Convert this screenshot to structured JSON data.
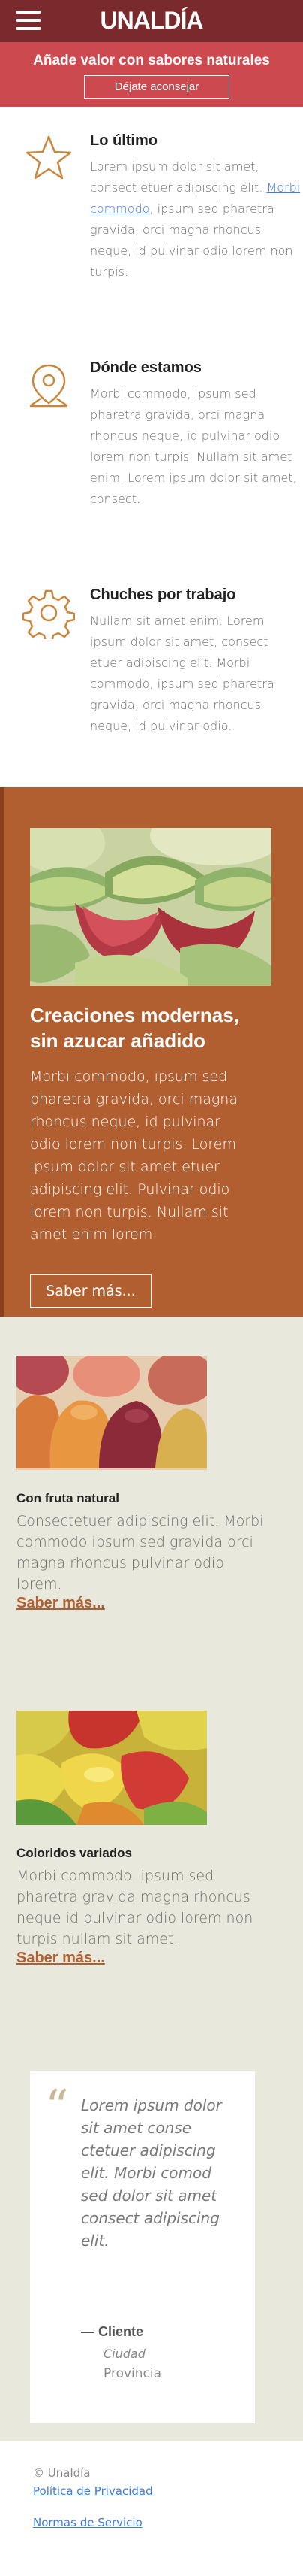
{
  "header": {
    "brand": "UNALDÍA",
    "menu_icon": "hamburger-menu-icon"
  },
  "promo": {
    "text": "Añade valor con sabores naturales",
    "button": "Déjate aconsejar"
  },
  "features": [
    {
      "icon": "star-icon",
      "title": "Lo último",
      "text_before": "Lorem ipsum dolor sit amet, consect etuer adipiscing elit.",
      "link": "Morbi commodo",
      "text_after": ", ipsum sed pharetra gravida, orci magna rhoncus neque, id pulvinar odio lorem non turpis."
    },
    {
      "icon": "map-pin-icon",
      "title": "Dónde estamos",
      "text": "Morbi commodo, ipsum sed pharetra gravida, orci magna rhoncus neque, id pulvinar odio lorem non turpis. Nullam sit amet enim. Lorem ipsum dolor sit amet, consect."
    },
    {
      "icon": "gear-icon",
      "title": "Chuches por trabajo",
      "text": "Nullam sit amet enim. Lorem ipsum dolor sit amet, consect etuer adipiscing elit. Morbi commodo, ipsum sed pharetra gravida, orci magna rhoncus neque, id pulvinar odio."
    }
  ],
  "highlight": {
    "title": "Creaciones modernas, sin azucar añadido",
    "text": "Morbi commodo, ipsum sed pharetra gravida, orci magna rhoncus neque, id pulvinar odio lorem non turpis. Lorem ipsum dolor sit amet etuer adipiscing elit. Pulvinar odio lorem non turpis. Nullam sit amet enim lorem.",
    "button": "Saber más..."
  },
  "cards": [
    {
      "title": "Con fruta natural",
      "text": "Consectetuer adipiscing elit. Morbi commodo ipsum sed gravida orci magna rhoncus pulvinar odio lorem.",
      "link": "Saber más..."
    },
    {
      "title": "Coloridos variados",
      "text": "Morbi commodo, ipsum sed pharetra gravida magna rhoncus neque id pulvinar odio lorem non turpis nullam sit amet.",
      "link": "Saber más..."
    }
  ],
  "testimonial": {
    "quote_mark": "“",
    "text": "Lorem ipsum dolor sit amet conse ctetuer adipiscing elit. Morbi comod sed dolor sit amet consect adipiscing elit.",
    "author": "— Cliente",
    "city": "Ciudad",
    "province": "Provincia"
  },
  "footer": {
    "copyright": "© Unaldía",
    "privacy": "Política de Privacidad",
    "terms": "Normas de Servicio"
  },
  "colors": {
    "header": "#7a2a2d",
    "promo": "#cc4a4f",
    "brown": "#b15f30",
    "beige": "#e9e8dc",
    "link": "#3d7ae0"
  }
}
